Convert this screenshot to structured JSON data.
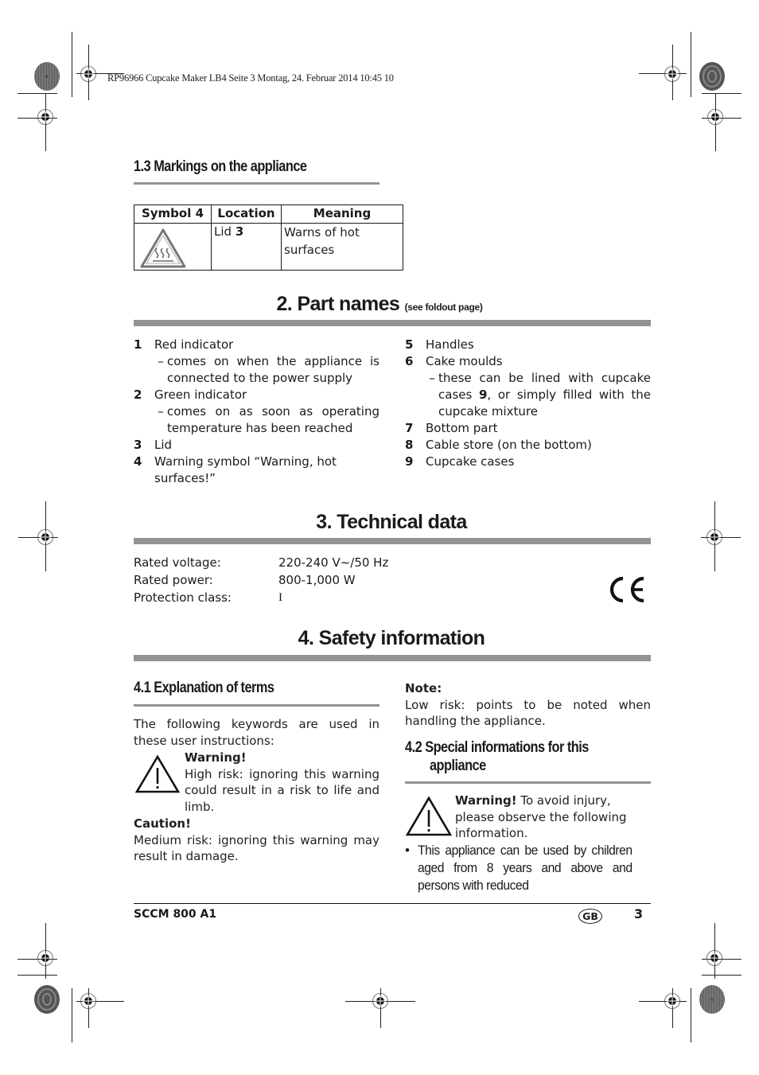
{
  "print_header": "RP96966 Cupcake Maker LB4  Seite 3  Montag, 24. Februar 2014  10:45 10",
  "section_1_3": {
    "title": "1.3 Markings on the appliance",
    "table": {
      "headers": [
        "Symbol 4",
        "Location",
        "Meaning"
      ],
      "rows": [
        {
          "symbol_icon": "hot-surface-warning-icon",
          "location_text": "Lid ",
          "location_num": "3",
          "meaning": "Warns of hot surfaces"
        }
      ]
    }
  },
  "section_2": {
    "title": "2. Part names",
    "title_note": "(see foldout page)",
    "left_items": [
      {
        "num": "1",
        "label": "Red indicator",
        "sub": "comes on when the appliance is connected to the power supply"
      },
      {
        "num": "2",
        "label": "Green indicator",
        "sub": "comes on as soon as operating temperature has been reached"
      },
      {
        "num": "3",
        "label": "Lid"
      },
      {
        "num": "4",
        "label": "Warning symbol “Warning, hot surfaces!”"
      }
    ],
    "right_items": [
      {
        "num": "5",
        "label": "Handles"
      },
      {
        "num": "6",
        "label": "Cake moulds",
        "sub_pre": "these can be lined with cupcake cases ",
        "sub_num": "9",
        "sub_post": ", or simply filled with the cupcake mixture"
      },
      {
        "num": "7",
        "label": "Bottom part"
      },
      {
        "num": "8",
        "label": "Cable store (on the bottom)"
      },
      {
        "num": "9",
        "label": "Cupcake cases"
      }
    ],
    "dash": "–"
  },
  "section_3": {
    "title": "3. Technical data",
    "rows": [
      {
        "label": "Rated voltage:",
        "value": "220-240 V~/50 Hz"
      },
      {
        "label": "Rated power:",
        "value": "800-1,000 W"
      },
      {
        "label": "Protection class:",
        "value": "I"
      }
    ],
    "ce_mark": "CE"
  },
  "section_4": {
    "title": "4. Safety information",
    "sub_4_1": {
      "title": "4.1 Explanation of terms",
      "intro": "The following keywords are used in these user instructions:",
      "warning_label": "Warning!",
      "warning_text": "High risk: ignoring this warning could result in a risk to life and limb.",
      "caution_label": "Caution!",
      "caution_text": "Medium risk: ignoring this warning may result in damage.",
      "note_label": "Note:",
      "note_text": "Low risk: points to be noted when handling the appliance."
    },
    "sub_4_2": {
      "title_line1": "4.2 Special informations for this",
      "title_line2": "appliance",
      "warning_label": "Warning!",
      "warning_text": " To avoid injury, please observe the following information.",
      "bullet": "•",
      "bullet_text": "This appliance can be used by children aged from 8 years and above and persons with reduced"
    }
  },
  "footer": {
    "model": "SCCM 800 A1",
    "country": "GB",
    "page": "3"
  }
}
